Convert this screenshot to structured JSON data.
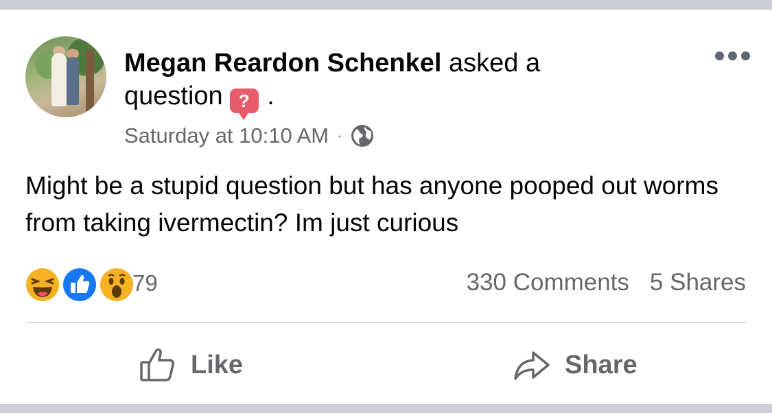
{
  "post": {
    "author_name": "Megan Reardon Schenkel",
    "action_text_1": "asked a",
    "action_text_2": "question",
    "action_end": ".",
    "question_badge": "?",
    "timestamp": "Saturday at 10:10 AM",
    "separator": "·",
    "privacy_icon": "globe-icon",
    "body": "Might be a stupid question but has anyone pooped out worms from taking ivermectin? Im just curious"
  },
  "reactions": {
    "icons": [
      "haha-icon",
      "like-icon",
      "wow-icon"
    ],
    "count": "79",
    "comments": "330 Comments",
    "shares": "5 Shares"
  },
  "actions": {
    "like_label": "Like",
    "share_label": "Share"
  },
  "colors": {
    "text": "#050505",
    "secondary": "#65676b",
    "like_blue": "#1877f2",
    "question_red": "#e85b6a",
    "reaction_yellow": "#f7b125"
  }
}
